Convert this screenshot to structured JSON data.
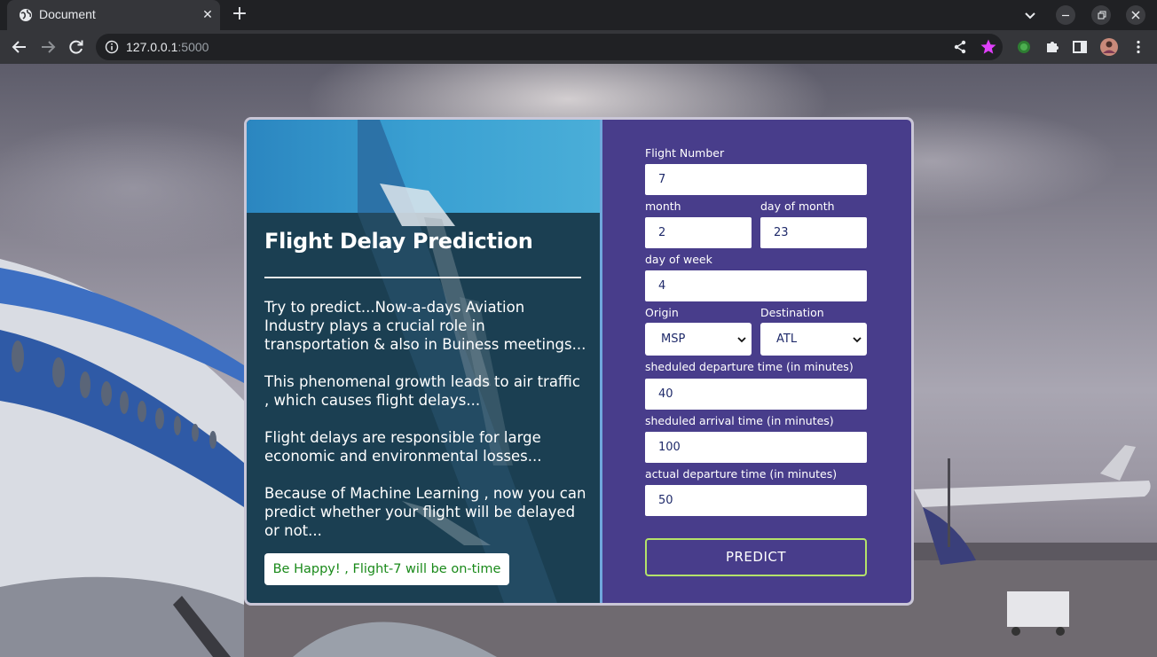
{
  "browser": {
    "tab_title": "Document",
    "tab_close": "✕",
    "new_tab": "+",
    "url_host": "127.0.0.1",
    "url_port": ":5000"
  },
  "page": {
    "title": "Flight Delay Prediction",
    "paragraphs": [
      "Try to predict...Now-a-days Aviation Industry plays a crucial role in transportation & also in Buiness meetings...",
      "This phenomenal growth leads to air traffic , which causes flight delays...",
      "Flight delays are responsible for large economic and environmental losses...",
      "Because of Machine Learning , now you can predict whether your flight will be delayed or not..."
    ],
    "result": "Be Happy! , Flight-7 will be on-time"
  },
  "form": {
    "flight_number": {
      "label": "Flight Number",
      "value": "7"
    },
    "month": {
      "label": "month",
      "value": "2"
    },
    "day_of_month": {
      "label": "day of month",
      "value": "23"
    },
    "day_of_week": {
      "label": "day of week",
      "value": "4"
    },
    "origin": {
      "label": "Origin",
      "value": "MSP"
    },
    "destination": {
      "label": "Destination",
      "value": "ATL"
    },
    "sched_dep": {
      "label": "sheduled departure time (in minutes)",
      "value": "40"
    },
    "sched_arr": {
      "label": "sheduled arrival time (in minutes)",
      "value": "100"
    },
    "actual_dep": {
      "label": "actual departure time (in minutes)",
      "value": "50"
    },
    "predict_label": "PREDICT"
  },
  "colors": {
    "chrome_dark": "#202124",
    "chrome_toolbar": "#35363a",
    "card_left": "#1b3f52",
    "card_right": "#483d8b",
    "result_text": "#1a8a1a",
    "predict_border": "#b4e26a",
    "bookmark_star": "#e040fb"
  },
  "icons": [
    "globe-icon",
    "close-icon",
    "plus-icon",
    "chevron-down-icon",
    "minimize-icon",
    "restore-icon",
    "back-icon",
    "forward-icon",
    "reload-icon",
    "info-icon",
    "share-icon",
    "star-icon",
    "extension-icon",
    "puzzle-icon",
    "sidepanel-icon",
    "avatar",
    "menu-icon"
  ]
}
